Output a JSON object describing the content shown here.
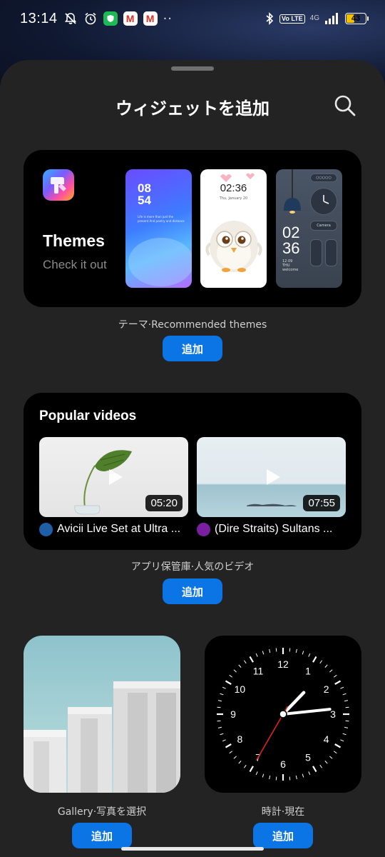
{
  "status_bar": {
    "time": "13:14",
    "network": "4G",
    "volte": "Vo LTE",
    "battery": "43",
    "battery_level_percent": 43,
    "icons": [
      "mute-icon",
      "alarm-icon",
      "shield-app-icon",
      "gmail-icon",
      "gmail-icon",
      "more-dots-icon",
      "bluetooth-icon",
      "signal-icon",
      "battery-icon"
    ]
  },
  "sheet": {
    "title": "ウィジェットを追加"
  },
  "widgets": {
    "themes": {
      "title": "Themes",
      "subtitle": "Check it out",
      "caption": "テーマ·Recommended themes",
      "add_label": "追加",
      "previews": {
        "p1_hour": "08",
        "p1_minute": "54",
        "p1_text": "Life is more than just the present And poetry and distance",
        "p2_time": "02:36",
        "p2_date": "Thu, January 20",
        "p3_hour": "02",
        "p3_minute": "36",
        "p3_date": "12·09",
        "p3_day": "THU",
        "p3_welcome": "welcome",
        "p3_camera": "Camera",
        "p3_dots": "○○○○○"
      }
    },
    "videos": {
      "title": "Popular videos",
      "caption": "アプリ保管庫·人気のビデオ",
      "add_label": "追加",
      "items": [
        {
          "title": "Avicii Live Set at Ultra ...",
          "duration": "05:20",
          "channel_color": "#1e5fa8"
        },
        {
          "title": "(Dire Straits) Sultans ...",
          "duration": "07:55",
          "channel_color": "#7a1fa2"
        }
      ]
    },
    "gallery": {
      "caption": "Gallery·写真を選択",
      "add_label": "追加"
    },
    "clock": {
      "caption": "時計·現在",
      "add_label": "追加",
      "numbers": [
        "12",
        "1",
        "2",
        "3",
        "4",
        "5",
        "6",
        "7",
        "8",
        "9",
        "10",
        "11"
      ],
      "hands": {
        "hour": 1.23,
        "minute": 14,
        "second": 35
      }
    }
  },
  "colors": {
    "accent": "#0b75e6",
    "sheet_bg": "#232323",
    "card_bg": "#000000",
    "second_hand": "#e02020"
  }
}
